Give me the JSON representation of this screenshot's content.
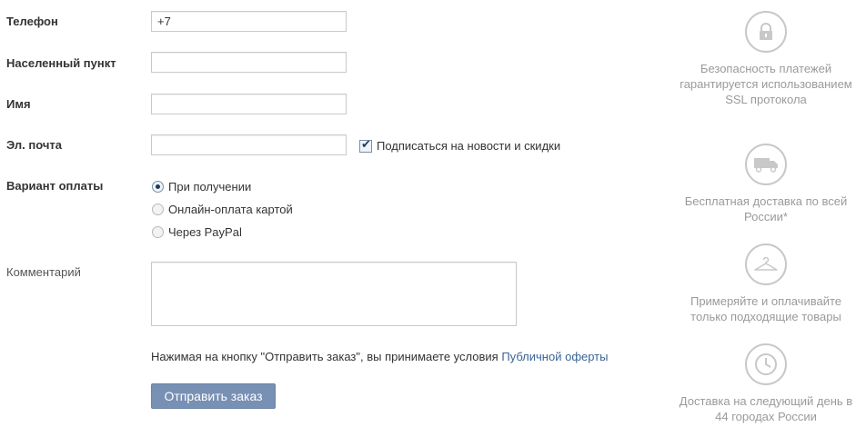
{
  "form": {
    "phone_label": "Телефон",
    "phone_value": "+7",
    "city_label": "Населенный пункт",
    "name_label": "Имя",
    "email_label": "Эл. почта",
    "subscribe_label": "Подписаться на новости и скидки",
    "payment_label": "Вариант оплаты",
    "payment_options": [
      "При получении",
      "Онлайн-оплата картой",
      "Через PayPal"
    ],
    "comment_label": "Комментарий",
    "terms_text": "Нажимая на кнопку \"Отправить заказ\", вы принимаете условия ",
    "terms_link": "Публичной оферты",
    "submit_label": "Отправить заказ"
  },
  "features": [
    {
      "icon": "lock-icon",
      "text": "Безопасность платежей гарантируется использованием SSL протокола"
    },
    {
      "icon": "truck-icon",
      "text": "Бесплатная доставка по всей России*"
    },
    {
      "icon": "hanger-icon",
      "text": "Примеряйте и оплачивайте только подходящие товары"
    },
    {
      "icon": "clock-icon",
      "text": "Доставка на следующий день в 44 городах России"
    }
  ],
  "colors": {
    "button": "#7790b4",
    "link": "#3a6395",
    "feature_text": "#9a9a9a",
    "icon_stroke": "#c8c8c8"
  }
}
